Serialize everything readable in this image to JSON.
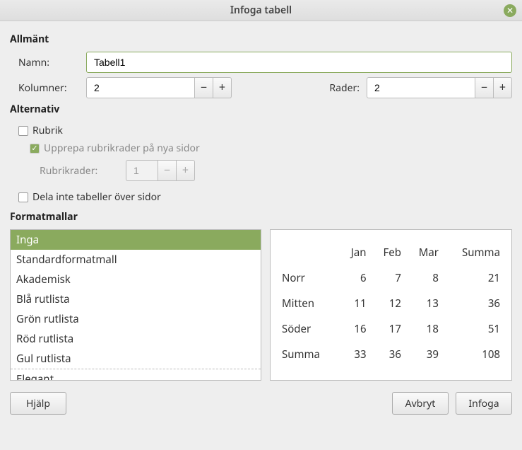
{
  "window": {
    "title": "Infoga tabell"
  },
  "general": {
    "title": "Allmänt",
    "name_label": "Namn:",
    "name_value": "Tabell1",
    "columns_label": "Kolumner:",
    "columns_value": "2",
    "rows_label": "Rader:",
    "rows_value": "2"
  },
  "options": {
    "title": "Alternativ",
    "heading_label": "Rubrik",
    "heading_checked": false,
    "repeat_label": "Upprepa rubrikrader på nya sidor",
    "repeat_checked": true,
    "repeat_disabled": true,
    "heading_rows_label": "Rubrikrader:",
    "heading_rows_value": "1",
    "dont_split_label": "Dela inte tabeller över sidor",
    "dont_split_checked": false
  },
  "styles": {
    "title": "Formatmallar",
    "items": [
      "Inga",
      "Standardformatmall",
      "Akademisk",
      "Blå rutlista",
      "Grön rutlista",
      "Röd rutlista",
      "Gul rutlista",
      "Elegant"
    ],
    "selected_index": 0
  },
  "preview": {
    "columns": [
      "Jan",
      "Feb",
      "Mar",
      "Summa"
    ],
    "rows": [
      {
        "name": "Norr",
        "v": [
          "6",
          "7",
          "8",
          "21"
        ]
      },
      {
        "name": "Mitten",
        "v": [
          "11",
          "12",
          "13",
          "36"
        ]
      },
      {
        "name": "Söder",
        "v": [
          "16",
          "17",
          "18",
          "51"
        ]
      },
      {
        "name": "Summa",
        "v": [
          "33",
          "36",
          "39",
          "108"
        ]
      }
    ]
  },
  "buttons": {
    "help": "Hjälp",
    "cancel": "Avbryt",
    "insert": "Infoga"
  },
  "chart_data": {
    "type": "table",
    "title": "",
    "columns": [
      "",
      "Jan",
      "Feb",
      "Mar",
      "Summa"
    ],
    "rows": [
      [
        "Norr",
        6,
        7,
        8,
        21
      ],
      [
        "Mitten",
        11,
        12,
        13,
        36
      ],
      [
        "Söder",
        16,
        17,
        18,
        51
      ],
      [
        "Summa",
        33,
        36,
        39,
        108
      ]
    ]
  }
}
